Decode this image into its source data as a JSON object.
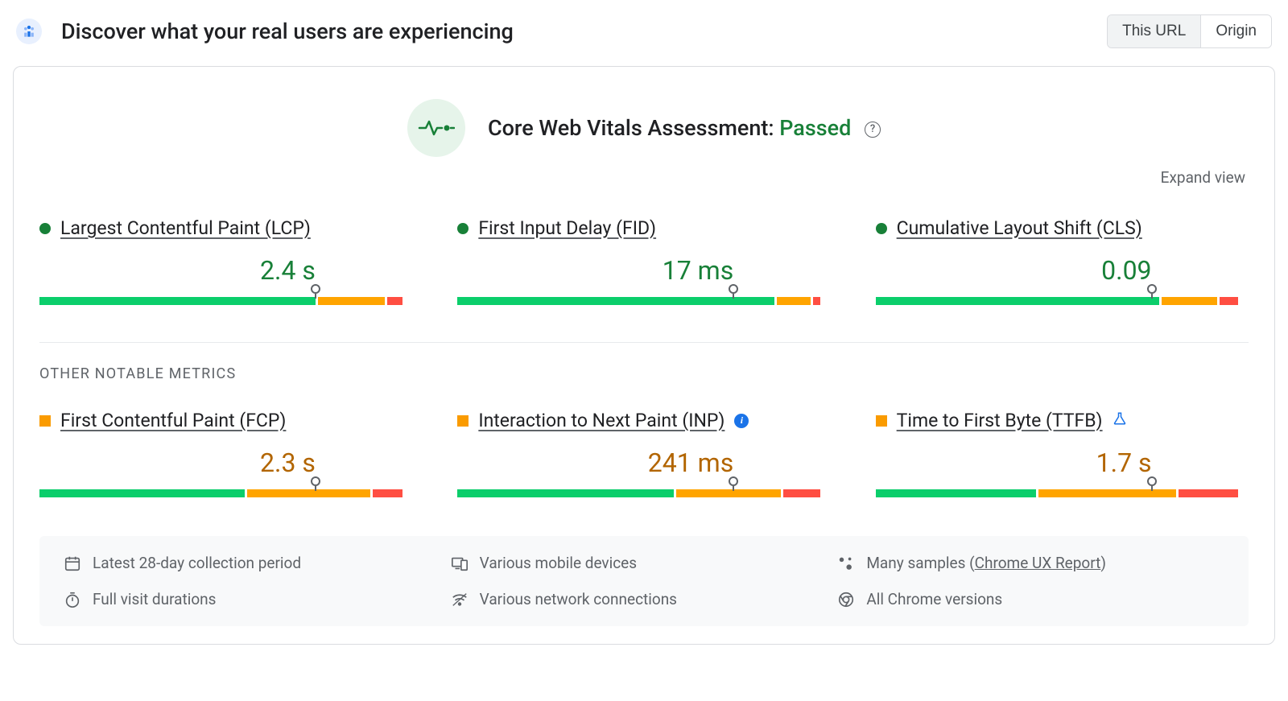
{
  "header": {
    "title": "Discover what your real users are experiencing",
    "toggle": {
      "this_url": "This URL",
      "origin": "Origin"
    }
  },
  "assessment": {
    "label": "Core Web Vitals Assessment:",
    "status": "Passed"
  },
  "expand": "Expand view",
  "core_metrics": [
    {
      "name": "Largest Contentful Paint (LCP)",
      "value": "2.4 s",
      "status": "good",
      "value_color": "green",
      "segments": [
        74,
        18,
        4
      ],
      "marker_pct": 74
    },
    {
      "name": "First Input Delay (FID)",
      "value": "17 ms",
      "status": "good",
      "value_color": "green",
      "segments": [
        85,
        9,
        2
      ],
      "marker_pct": 74
    },
    {
      "name": "Cumulative Layout Shift (CLS)",
      "value": "0.09",
      "status": "good",
      "value_color": "green",
      "segments": [
        76,
        15,
        5
      ],
      "marker_pct": 74
    }
  ],
  "other_label": "OTHER NOTABLE METRICS",
  "other_metrics": [
    {
      "name": "First Contentful Paint (FCP)",
      "value": "2.3 s",
      "status": "ni",
      "value_color": "orange",
      "segments": [
        55,
        33,
        8
      ],
      "marker_pct": 74,
      "badge": null
    },
    {
      "name": "Interaction to Next Paint (INP)",
      "value": "241 ms",
      "status": "ni",
      "value_color": "orange",
      "segments": [
        58,
        28,
        10
      ],
      "marker_pct": 74,
      "badge": "info"
    },
    {
      "name": "Time to First Byte (TTFB)",
      "value": "1.7 s",
      "status": "ni",
      "value_color": "orange",
      "segments": [
        43,
        37,
        16
      ],
      "marker_pct": 74,
      "badge": "flask"
    }
  ],
  "footer": {
    "period": "Latest 28-day collection period",
    "devices": "Various mobile devices",
    "samples_prefix": "Many samples (",
    "samples_link": "Chrome UX Report",
    "samples_suffix": ")",
    "durations": "Full visit durations",
    "network": "Various network connections",
    "versions": "All Chrome versions"
  }
}
